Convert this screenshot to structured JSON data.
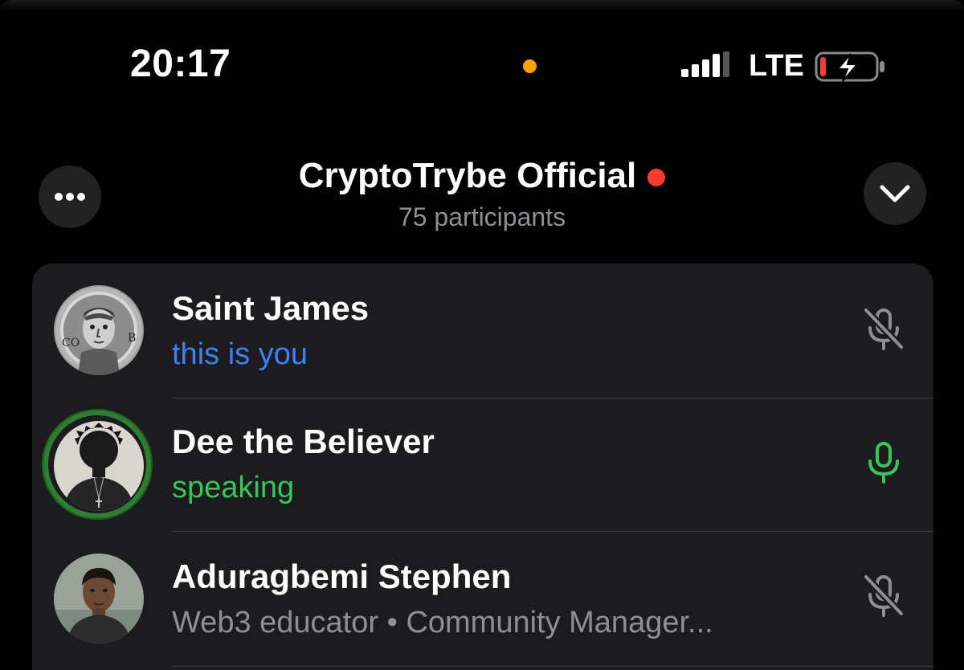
{
  "status_bar": {
    "time": "20:17",
    "privacy_indicator_color": "#ff9f0a",
    "signal_icon": "cellular-signal-icon",
    "network": "LTE",
    "battery_icon": "battery-charging-low-icon",
    "battery_level": 0.1
  },
  "header": {
    "more_icon": "ellipsis-icon",
    "title": "CryptoTrybe Official",
    "live_indicator_color": "#ff3b30",
    "participants": "75 participants",
    "collapse_icon": "chevron-down-icon"
  },
  "participants": [
    {
      "name": "Saint James",
      "status": "this is you",
      "status_color": "#3b82f6",
      "mic_icon": "mic-muted-icon",
      "mic_color": "#8e8e93",
      "speaking": false
    },
    {
      "name": "Dee the Believer",
      "status": "speaking",
      "status_color": "#34c759",
      "mic_icon": "mic-active-icon",
      "mic_color": "#34c759",
      "speaking": true
    },
    {
      "name": "Aduragbemi Stephen",
      "status": "Web3 educator • Community Manager...",
      "status_color": "#8e8e93",
      "mic_icon": "mic-muted-icon",
      "mic_color": "#8e8e93",
      "speaking": false
    }
  ],
  "colors": {
    "background": "#000000",
    "card": "#1c1c1e",
    "secondary_text": "#8e8e93",
    "speaking_ring": "#2e7d32"
  }
}
